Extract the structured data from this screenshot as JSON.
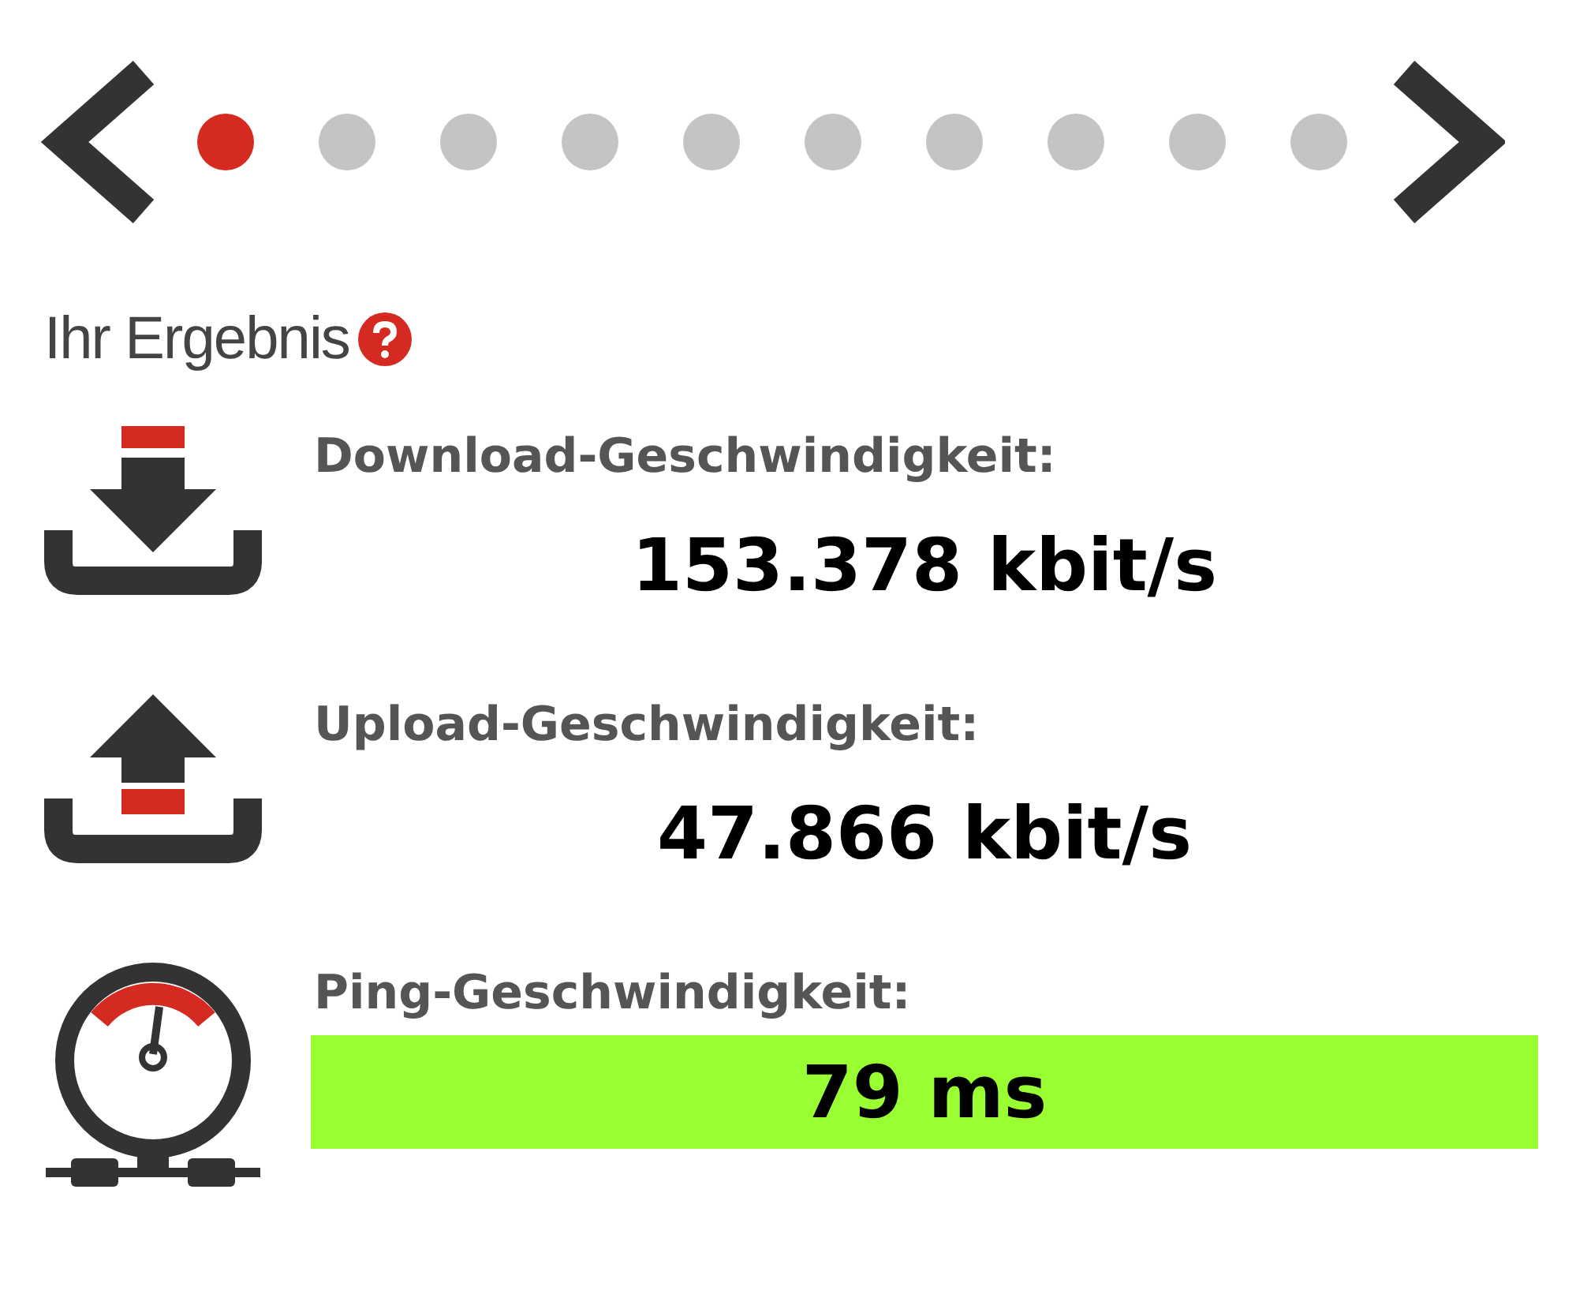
{
  "carousel": {
    "dots": [
      {
        "selected": true
      },
      {
        "selected": false
      },
      {
        "selected": false
      },
      {
        "selected": false
      },
      {
        "selected": false
      },
      {
        "selected": false
      },
      {
        "selected": false
      },
      {
        "selected": false
      },
      {
        "selected": false
      },
      {
        "selected": false
      }
    ]
  },
  "heading": "Ihr Ergebnis",
  "results": [
    {
      "kind": "download",
      "label": "Download-Geschwindigkeit:",
      "value": "153.378 kbit/s",
      "highlighted": false
    },
    {
      "kind": "upload",
      "label": "Upload-Geschwindigkeit:",
      "value": "47.866 kbit/s",
      "highlighted": false
    },
    {
      "kind": "ping",
      "label": "Ping-Geschwindigkeit:",
      "value": "79 ms",
      "highlighted": true
    }
  ]
}
